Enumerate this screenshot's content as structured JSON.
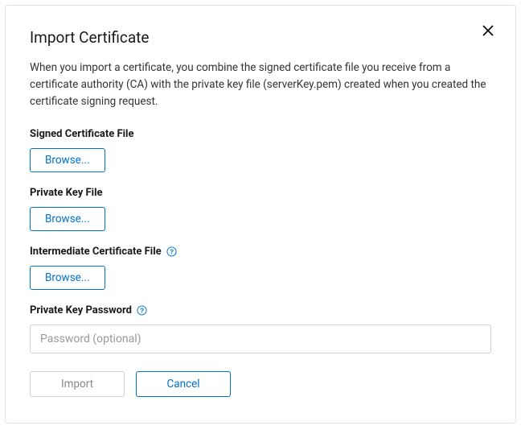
{
  "dialog": {
    "title": "Import Certificate",
    "description": "When you import a certificate, you combine the signed certificate file you receive from a certificate authority (CA) with the private key file (serverKey.pem) created when you created the certificate signing request.",
    "fields": {
      "signed_cert": {
        "label": "Signed Certificate File",
        "browse": "Browse..."
      },
      "private_key": {
        "label": "Private Key File",
        "browse": "Browse..."
      },
      "intermediate": {
        "label": "Intermediate Certificate File",
        "browse": "Browse..."
      },
      "password": {
        "label": "Private Key Password",
        "placeholder": "Password (optional)"
      }
    },
    "actions": {
      "import": "Import",
      "cancel": "Cancel"
    }
  }
}
